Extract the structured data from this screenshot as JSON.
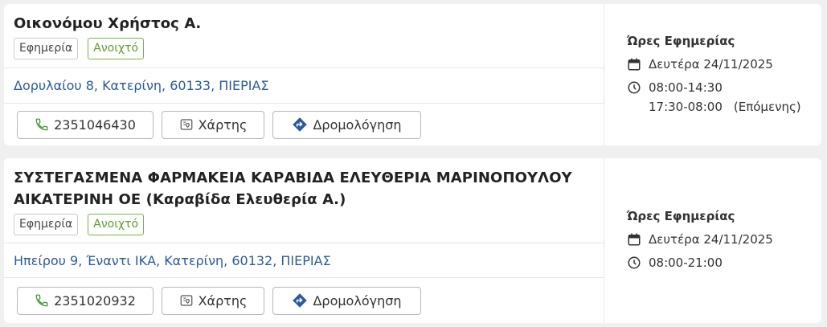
{
  "pharmacies": [
    {
      "name": "Οικονόμου Χρήστος Α.",
      "badge_duty": "Εφημερία",
      "badge_open": "Ανοιχτό",
      "address": "Δορυλαίου 8, Κατερίνη, 60133, ΠΙΕΡΙΑΣ",
      "phone": "2351046430",
      "map_label": "Χάρτης",
      "route_label": "Δρομολόγηση",
      "hours_title": "Ώρες Εφημερίας",
      "date": "Δευτέρα 24/11/2025",
      "hours_1": "08:00-14:30",
      "hours_2": "17:30-08:00",
      "hours_2_note": "(Επόμενης)"
    },
    {
      "name": "ΣΥΣΤΕΓΑΣΜΕΝΑ ΦΑΡΜΑΚΕΙΑ ΚΑΡΑΒΙΔΑ ΕΛΕΥΘΕΡΙΑ ΜΑΡΙΝΟΠΟΥΛΟΥ ΑΙΚΑΤΕΡΙΝΗ ΟΕ (Καραβίδα Ελευθερία Α.)",
      "badge_duty": "Εφημερία",
      "badge_open": "Ανοιχτό",
      "address": "Ηπείρου 9, Έναντι ΙΚΑ, Κατερίνη, 60132, ΠΙΕΡΙΑΣ",
      "phone": "2351020932",
      "map_label": "Χάρτης",
      "route_label": "Δρομολόγηση",
      "hours_title": "Ώρες Εφημερίας",
      "date": "Δευτέρα 24/11/2025",
      "hours_1": "08:00-21:00"
    }
  ],
  "colors": {
    "accent_green": "#5a9e2f",
    "link_blue": "#2a5a9b",
    "route_blue": "#2a5a9b",
    "phone_green": "#4a9a3a"
  },
  "icons": [
    "phone-icon",
    "map-icon",
    "route-icon",
    "calendar-icon",
    "clock-icon"
  ]
}
